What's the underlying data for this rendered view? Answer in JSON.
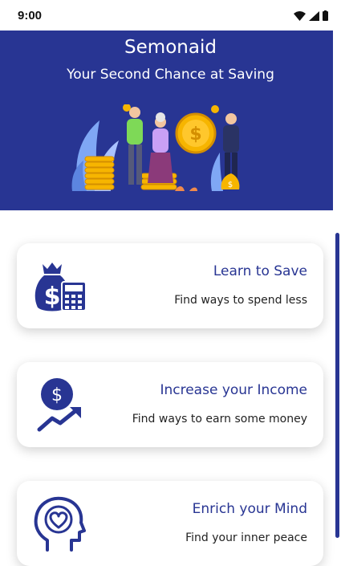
{
  "status_bar": {
    "time": "9:00"
  },
  "header": {
    "title": "Semonaid",
    "subtitle": "Your Second Chance at Saving"
  },
  "cards": [
    {
      "title": "Learn to Save",
      "description": "Find ways to spend less",
      "icon": "money-bag-calculator-icon"
    },
    {
      "title": "Increase your Income",
      "description": "Find ways to earn some money",
      "icon": "dollar-growth-icon"
    },
    {
      "title": "Enrich your Mind",
      "description": "Find your inner peace",
      "icon": "head-heart-icon"
    }
  ],
  "colors": {
    "primary": "#283593",
    "accent": "#f7b500",
    "background": "#ffffff"
  }
}
